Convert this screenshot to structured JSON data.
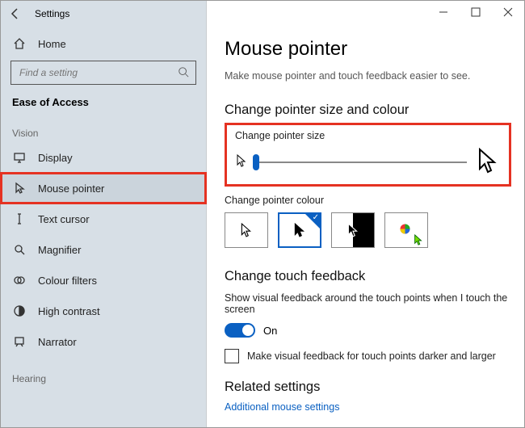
{
  "window": {
    "app_title": "Settings"
  },
  "sidebar": {
    "home_label": "Home",
    "search_placeholder": "Find a setting",
    "section_heading": "Ease of Access",
    "group_vision_label": "Vision",
    "group_hearing_label": "Hearing",
    "items": [
      {
        "label": "Display"
      },
      {
        "label": "Mouse pointer"
      },
      {
        "label": "Text cursor"
      },
      {
        "label": "Magnifier"
      },
      {
        "label": "Colour filters"
      },
      {
        "label": "High contrast"
      },
      {
        "label": "Narrator"
      }
    ]
  },
  "main": {
    "title": "Mouse pointer",
    "subtitle": "Make mouse pointer and touch feedback easier to see.",
    "size_colour_heading": "Change pointer size and colour",
    "size_label": "Change pointer size",
    "colour_label": "Change pointer colour",
    "touch_heading": "Change touch feedback",
    "touch_body": "Show visual feedback around the touch points when I touch the screen",
    "toggle_state": "On",
    "darker_larger": "Make visual feedback for touch points darker and larger",
    "related_heading": "Related settings",
    "related_link": "Additional mouse settings"
  }
}
